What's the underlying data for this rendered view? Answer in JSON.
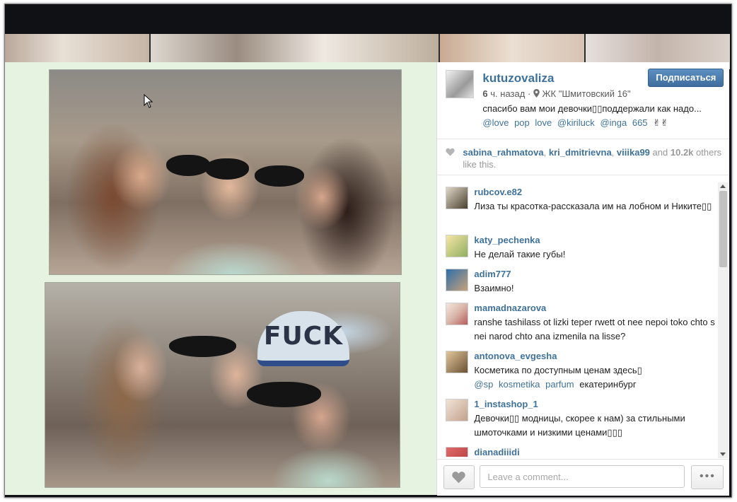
{
  "post": {
    "username": "kutuzovaliza",
    "follow_label": "Подписаться",
    "time_value": "6",
    "time_unit": "ч. назад",
    "separator": "·",
    "location": "ЖК \"Шмитовский 16\"",
    "caption": "спасибо вам мои девочки▯▯поддержали как надо...",
    "tags": [
      "@love",
      "pop",
      "love",
      "@kiriluck",
      "@inga",
      "665",
      "✌✌"
    ]
  },
  "photo": {
    "cap_text": "FUCK"
  },
  "likes": {
    "users": [
      "sabina_rahmatova",
      "kri_dmitrievna",
      "viiika99"
    ],
    "and_label": "and",
    "count": "10.2k",
    "suffix": "others like this."
  },
  "comments": [
    {
      "user": "rubcov.e82",
      "text": "Лиза ты красотка-рассказала им на лобном и Никите▯▯",
      "avatar_color": "#4a4030"
    },
    {
      "user": "katy_pechenka",
      "text": "Не делай такие губы!",
      "avatar_color": "#8fae5e"
    },
    {
      "user": "adim777",
      "text": "Взаимно!",
      "avatar_color": "#c8a27a"
    },
    {
      "user": "mamadnazarova",
      "text": "ranshe tashilass ot lizki teper rwett ot nee nepoi toko chto s nei narod chto ana izmenila na lisse?",
      "avatar_color": "#d9b5a8"
    },
    {
      "user": "antonova_evgesha",
      "text_before": "Косметика по доступным ценам здесь▯",
      "tags": [
        "@sp",
        "kosmetika",
        "parfum"
      ],
      "text_after": "екатеринбург",
      "avatar_color": "#6b5033"
    },
    {
      "user": "1_instashop_1",
      "text": "Девочки▯▯ модницы, скорее к нам) за стильными шмоточками и низкими ценами▯▯▯",
      "avatar_color": "#c2a28c"
    },
    {
      "user": "dianadiiidi",
      "text": "",
      "avatar_color": "#b03a3a"
    }
  ],
  "comment_input": {
    "placeholder": "Leave a comment...",
    "value": ""
  },
  "more_label": "•••",
  "colors": {
    "link": "#3f729b",
    "button": "#3f6e9e",
    "photo_bg": "#e6f3e0"
  },
  "icons": [
    "map-pin-icon",
    "heart-icon",
    "cursor-icon"
  ]
}
